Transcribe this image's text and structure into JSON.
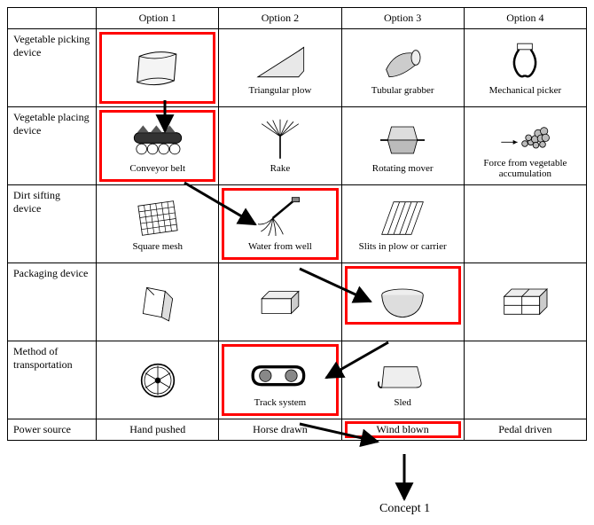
{
  "headers": {
    "blank": "",
    "opt1": "Option 1",
    "opt2": "Option 2",
    "opt3": "Option 3",
    "opt4": "Option 4"
  },
  "rows": {
    "r1": {
      "label": "Vegetable picking device",
      "c1": "",
      "c2": "Triangular plow",
      "c3": "Tubular grabber",
      "c4": "Mechanical picker"
    },
    "r2": {
      "label": "Vegetable placing device",
      "c1": "Conveyor belt",
      "c2": "Rake",
      "c3": "Rotating mover",
      "c4": "Force from vegetable accumulation"
    },
    "r3": {
      "label": "Dirt sifting device",
      "c1": "Square mesh",
      "c2": "Water from well",
      "c3": "Slits in plow or carrier",
      "c4": ""
    },
    "r4": {
      "label": "Packaging device",
      "c1": "",
      "c2": "",
      "c3": "",
      "c4": ""
    },
    "r5": {
      "label": "Method of transportation",
      "c1": "",
      "c2": "Track system",
      "c3": "Sled",
      "c4": ""
    },
    "r6": {
      "label": "Power source",
      "c1": "Hand pushed",
      "c2": "Horse drawn",
      "c3": "Wind blown",
      "c4": "Pedal driven"
    }
  },
  "concept_label": "Concept 1",
  "chart_data": {
    "type": "table",
    "title": "Morphological chart with selected concept path",
    "row_categories": [
      "Vegetable picking device",
      "Vegetable placing device",
      "Dirt sifting device",
      "Packaging device",
      "Method of transportation",
      "Power source"
    ],
    "column_categories": [
      "Option 1",
      "Option 2",
      "Option 3",
      "Option 4"
    ],
    "cells": [
      [
        "(curved sheet)",
        "Triangular plow",
        "Tubular grabber",
        "Mechanical picker"
      ],
      [
        "Conveyor belt",
        "Rake",
        "Rotating mover",
        "Force from vegetable accumulation"
      ],
      [
        "Square mesh",
        "Water from well",
        "Slits in plow or carrier",
        ""
      ],
      [
        "(folded carton)",
        "(open box)",
        "(bowl)",
        "(compartment tray)"
      ],
      [
        "(wheel)",
        "Track system",
        "Sled",
        ""
      ],
      [
        "Hand pushed",
        "Horse drawn",
        "Wind blown",
        "Pedal driven"
      ]
    ],
    "selected_path": [
      {
        "row": "Vegetable picking device",
        "option": 1
      },
      {
        "row": "Vegetable placing device",
        "option": 1
      },
      {
        "row": "Dirt sifting device",
        "option": 2
      },
      {
        "row": "Packaging device",
        "option": 3
      },
      {
        "row": "Method of transportation",
        "option": 2
      },
      {
        "row": "Power source",
        "option": 3
      }
    ],
    "selected_path_label": "Concept 1"
  }
}
